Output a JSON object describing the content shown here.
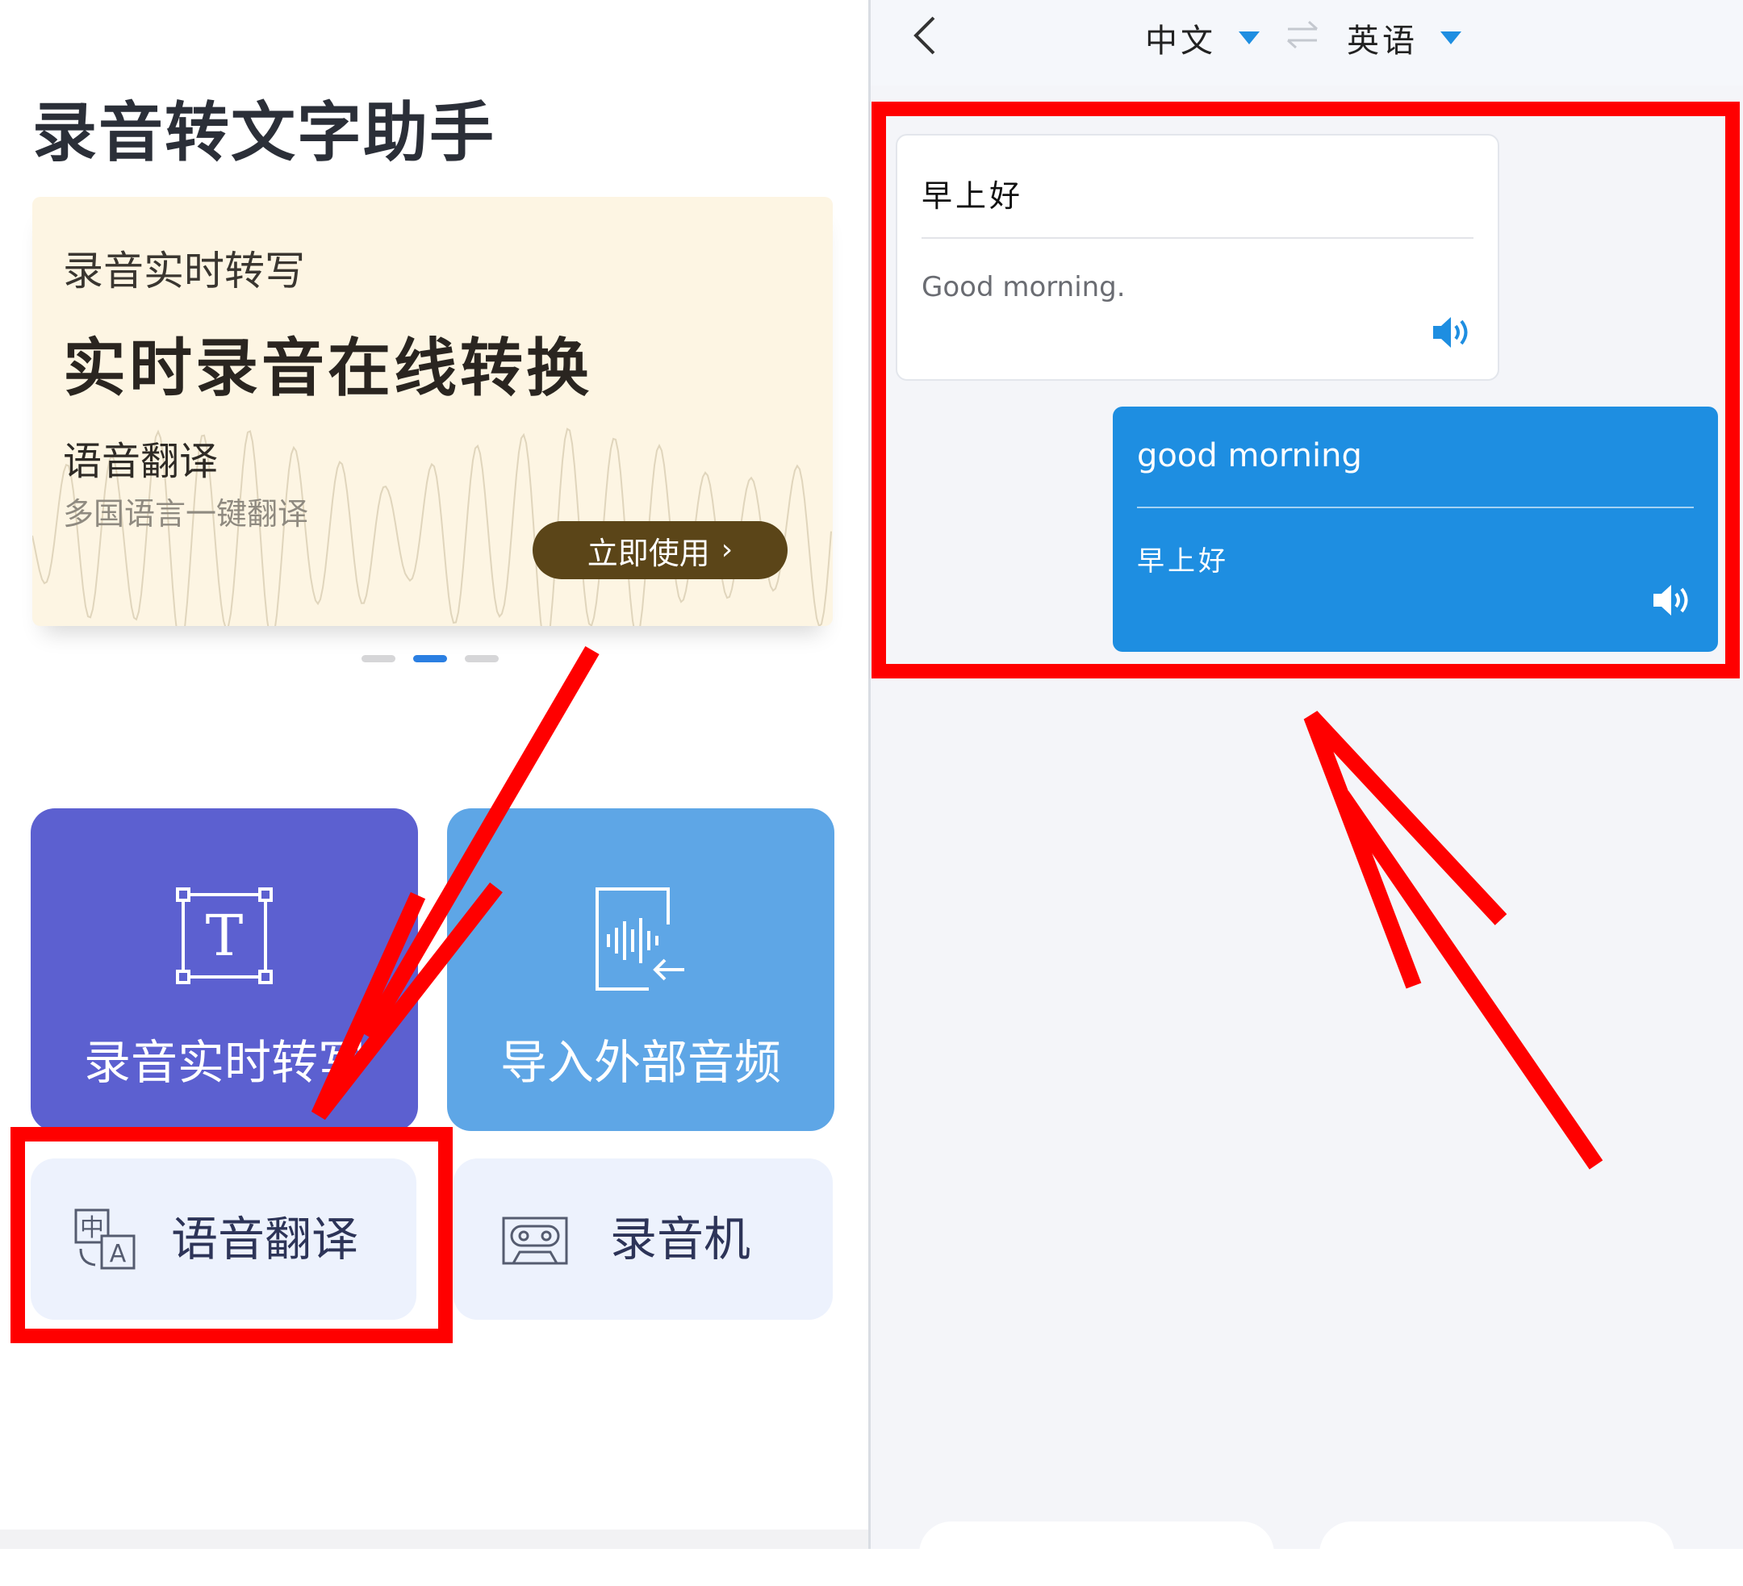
{
  "left": {
    "app_title": "录音转文字助手",
    "banner": {
      "kicker": "录音实时转写",
      "headline": "实时录音在线转换",
      "feature": "语音翻译",
      "feature_desc": "多国语言一键翻译",
      "cta_label": "立即使用",
      "cta_chevron": "›"
    },
    "carousel": {
      "count": 3,
      "active_index": 1
    },
    "tiles": {
      "transcribe_label": "录音实时转写",
      "import_label": "导入外部音频",
      "translate_label": "语音翻译",
      "recorder_label": "录音机"
    },
    "icons": {
      "transcribe": "text-frame-icon",
      "import": "import-audio-icon",
      "translate": "translate-icon",
      "recorder": "cassette-icon"
    },
    "translate_icon_glyphs": {
      "cn": "中",
      "en": "A"
    },
    "transcribe_icon_glyph": "T"
  },
  "right": {
    "source_language": "中文",
    "target_language": "英语",
    "messages": [
      {
        "source_text": "早上好",
        "translated_text": "Good morning."
      },
      {
        "source_text": "good morning",
        "translated_text": "早上好"
      }
    ]
  },
  "colors": {
    "accent_blue": "#1e8ee1",
    "tile_purple": "#5c60d0",
    "tile_light_blue": "#5ea6e6",
    "tile_pale": "#edf2fd",
    "banner_bg": "#fdf5e3",
    "cta_brown": "#5b4518",
    "annotation_red": "#ff0000"
  }
}
